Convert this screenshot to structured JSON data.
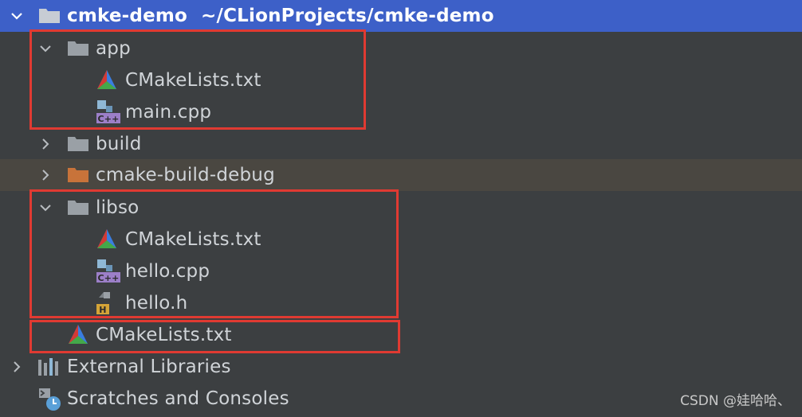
{
  "project": {
    "name": "cmke-demo",
    "path": "~/CLionProjects/cmke-demo"
  },
  "tree": {
    "app": {
      "label": "app",
      "files": [
        "CMakeLists.txt",
        "main.cpp"
      ]
    },
    "build": {
      "label": "build"
    },
    "cmake_build_debug": {
      "label": "cmake-build-debug"
    },
    "libso": {
      "label": "libso",
      "files": [
        "CMakeLists.txt",
        "hello.cpp",
        "hello.h"
      ]
    },
    "root_cmakelists": {
      "label": "CMakeLists.txt"
    },
    "external_libraries": {
      "label": "External Libraries"
    },
    "scratches": {
      "label": "Scratches and Consoles"
    }
  },
  "icon_names": {
    "folder": "folder-icon",
    "orange_folder": "excluded-folder-icon",
    "cmake": "cmake-icon",
    "cpp": "cpp-file-icon",
    "header": "header-file-icon",
    "libraries": "library-icon",
    "scratches": "scratches-icon"
  },
  "colors": {
    "background": "#3c3f41",
    "selection": "#3d60c8",
    "highlight_row": "#4a4741",
    "annotation_box": "#e03a32",
    "folder_gray": "#9aa0a6",
    "folder_orange": "#c8733a"
  },
  "watermark": "CSDN @娃哈哈、"
}
